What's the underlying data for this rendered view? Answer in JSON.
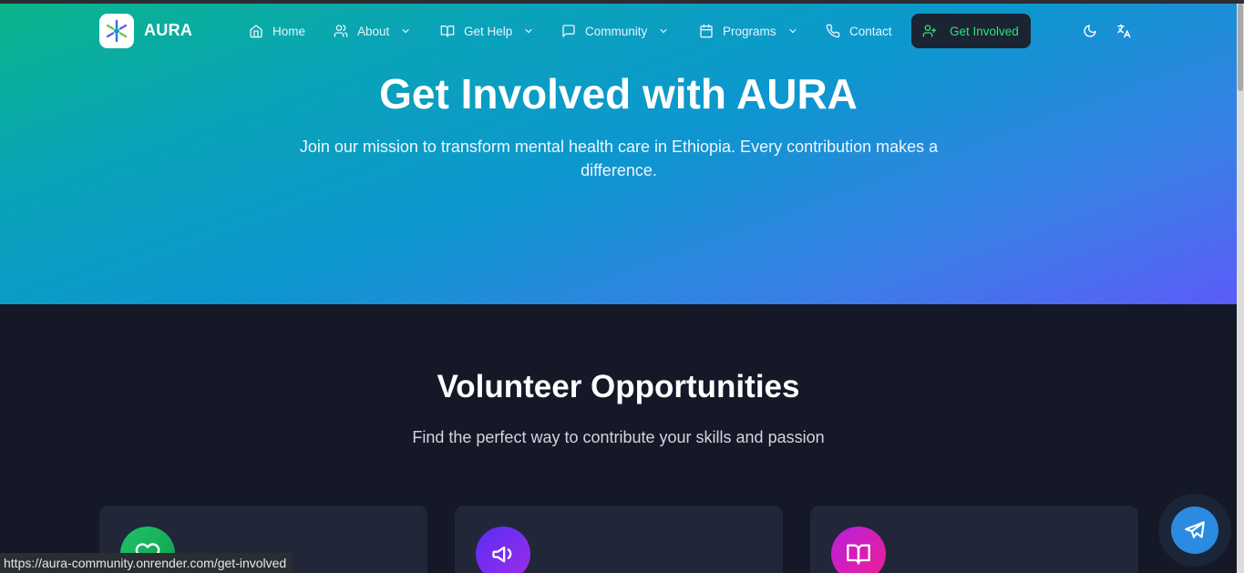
{
  "app": {
    "brand": "AURA",
    "logo_icon": "aura-logo-icon"
  },
  "nav": {
    "items": [
      {
        "label": "Home",
        "icon": "home-icon",
        "has_dropdown": false
      },
      {
        "label": "About",
        "icon": "users-icon",
        "has_dropdown": true
      },
      {
        "label": "Get Help",
        "icon": "book-open-icon",
        "has_dropdown": true
      },
      {
        "label": "Community",
        "icon": "message-square-icon",
        "has_dropdown": true
      },
      {
        "label": "Programs",
        "icon": "calendar-icon",
        "has_dropdown": true
      },
      {
        "label": "Contact",
        "icon": "phone-icon",
        "has_dropdown": false
      }
    ],
    "cta": {
      "label": "Get Involved",
      "icon": "user-plus-icon"
    },
    "theme_toggle_icon": "moon-icon",
    "language_icon": "translate-icon"
  },
  "hero": {
    "title": "Get Involved with AURA",
    "subtitle": "Join our mission to transform mental health care in Ethiopia. Every contribution makes a difference."
  },
  "section": {
    "title": "Volunteer Opportunities",
    "subtitle": "Find the perfect way to contribute your skills and passion"
  },
  "cards": [
    {
      "icon": "heart-icon",
      "color": "#16b35a"
    },
    {
      "icon": "megaphone-icon",
      "color": "#7b2ff7"
    },
    {
      "icon": "book-icon",
      "color": "#d21fc0"
    }
  ],
  "status_url": "https://aura-community.onrender.com/get-involved",
  "floating": {
    "icon": "telegram-icon",
    "color": "#2a8be0"
  },
  "colors": {
    "accent_green": "#2ee07f",
    "page_bg": "#141827",
    "card_bg": "#212738"
  }
}
